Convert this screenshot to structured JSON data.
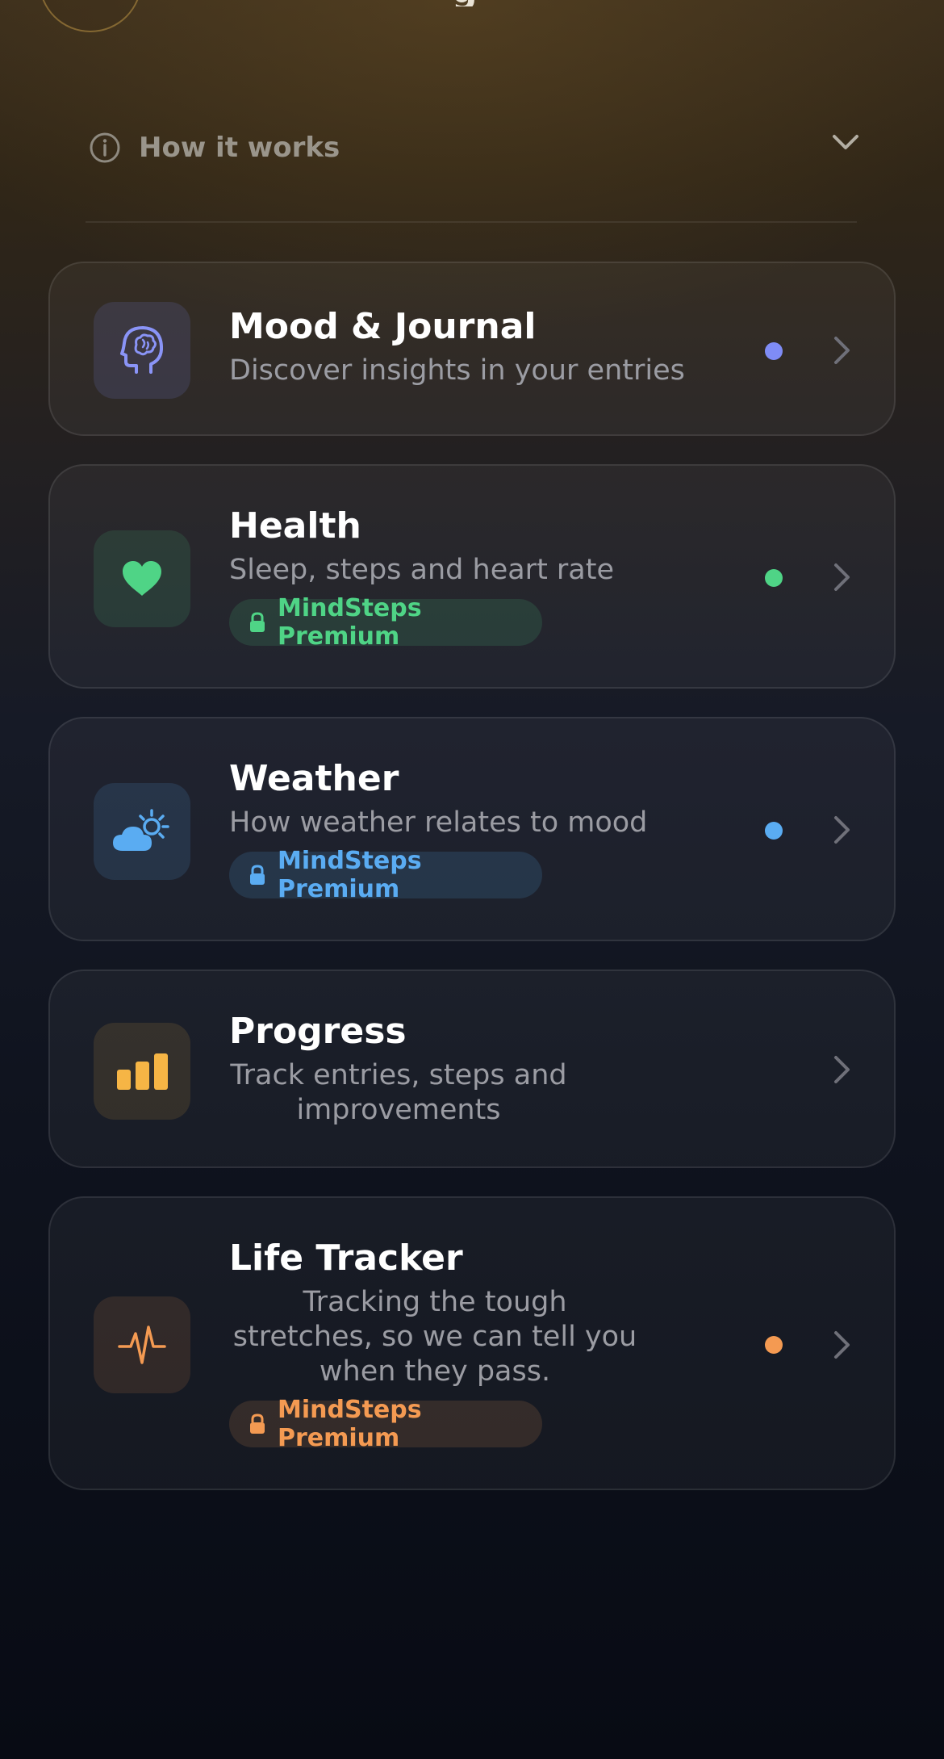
{
  "header": {
    "title_fragment": "g"
  },
  "how_it_works": {
    "label": "How it works"
  },
  "cards": [
    {
      "title": "Mood & Journal",
      "subtitle": "Discover insights in your entries",
      "icon": "brain-head-icon",
      "accent": "#7f8cf5",
      "has_dot": true
    },
    {
      "title": "Health",
      "subtitle": "Sleep, steps and heart rate",
      "icon": "heart-icon",
      "accent": "#4fd486",
      "badge": "MindSteps Premium",
      "has_dot": true
    },
    {
      "title": "Weather",
      "subtitle": "How weather relates to mood",
      "icon": "cloud-sun-icon",
      "accent": "#5aacf2",
      "badge": "MindSteps Premium",
      "has_dot": true
    },
    {
      "title": "Progress",
      "subtitle": "Track entries, steps and improvements",
      "icon": "bar-chart-icon",
      "accent": "#f6b545",
      "has_dot": false
    },
    {
      "title": "Life Tracker",
      "subtitle": "Tracking the tough stretches, so we can tell you when they pass.",
      "icon": "pulse-icon",
      "accent": "#f49a52",
      "badge": "MindSteps Premium",
      "has_dot": true
    }
  ]
}
